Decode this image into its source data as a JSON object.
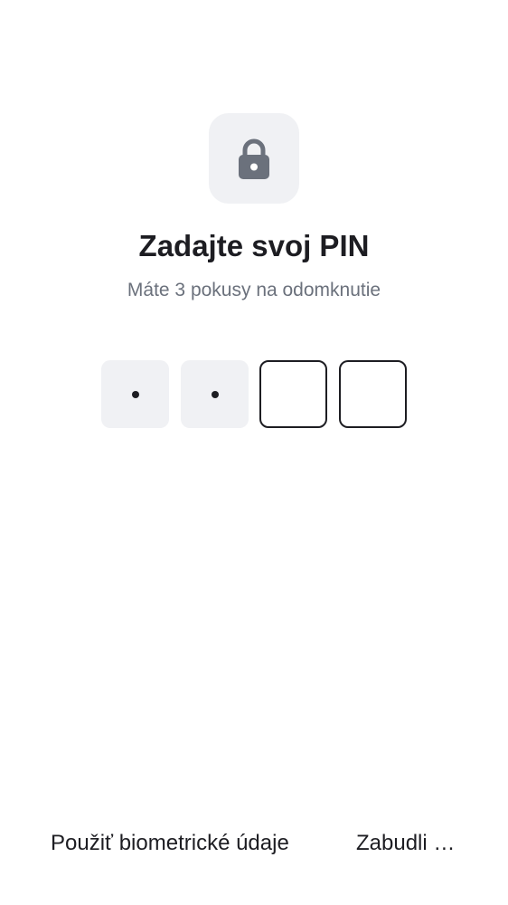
{
  "lock": {
    "icon": "lock-icon"
  },
  "header": {
    "title": "Zadajte svoj PIN",
    "subtitle": "Máte 3 pokusy na odomknutie"
  },
  "pin": {
    "length": 4,
    "entered": 2
  },
  "actions": {
    "biometric_label": "Použiť biometrické údaje",
    "forgot_label": "Zabudli …"
  },
  "colors": {
    "tile_bg": "#f0f1f4",
    "text": "#1d1d22",
    "muted": "#6b717c",
    "icon": "#6b717c"
  }
}
